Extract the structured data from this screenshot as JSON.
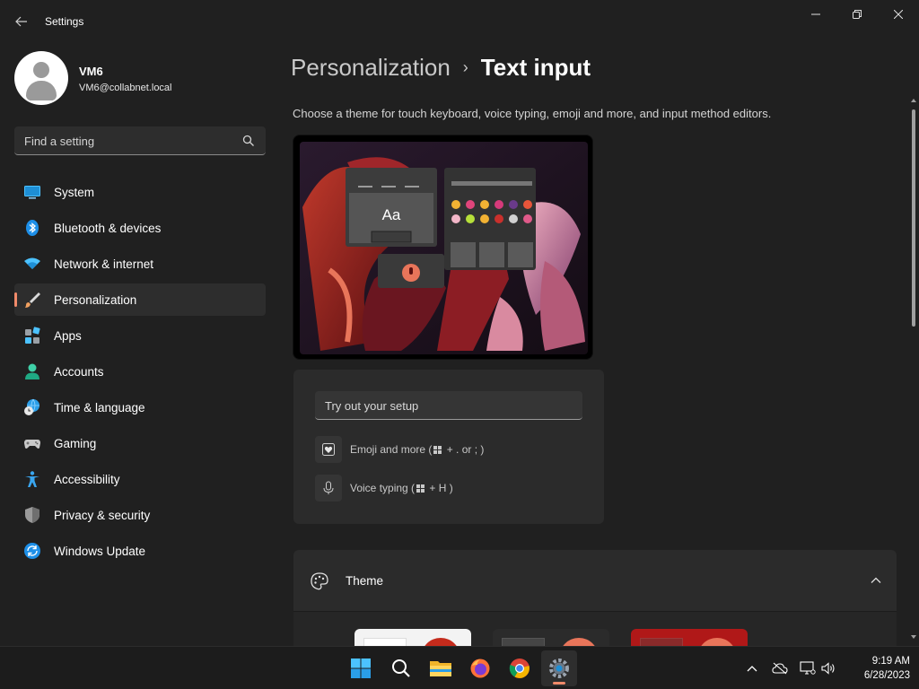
{
  "window": {
    "title": "Settings",
    "back_icon": "back-arrow-icon",
    "controls": [
      "minimize-icon",
      "restore-icon",
      "close-icon"
    ]
  },
  "profile": {
    "name": "VM6",
    "email": "VM6@collabnet.local"
  },
  "search": {
    "placeholder": "Find a setting"
  },
  "sidebar": {
    "items": [
      {
        "label": "System",
        "icon": "system-icon",
        "active": false
      },
      {
        "label": "Bluetooth & devices",
        "icon": "bluetooth-icon",
        "active": false
      },
      {
        "label": "Network & internet",
        "icon": "wifi-icon",
        "active": false
      },
      {
        "label": "Personalization",
        "icon": "brush-icon",
        "active": true
      },
      {
        "label": "Apps",
        "icon": "apps-icon",
        "active": false
      },
      {
        "label": "Accounts",
        "icon": "accounts-icon",
        "active": false
      },
      {
        "label": "Time & language",
        "icon": "globe-clock-icon",
        "active": false
      },
      {
        "label": "Gaming",
        "icon": "gamepad-icon",
        "active": false
      },
      {
        "label": "Accessibility",
        "icon": "accessibility-icon",
        "active": false
      },
      {
        "label": "Privacy & security",
        "icon": "shield-icon",
        "active": false
      },
      {
        "label": "Windows Update",
        "icon": "update-icon",
        "active": false
      }
    ]
  },
  "breadcrumb": {
    "parent": "Personalization",
    "separator": "›",
    "current": "Text input"
  },
  "main": {
    "description": "Choose a theme for touch keyboard, voice typing, emoji and more, and input method editors.",
    "preview": {
      "keyboard_sample": "Aa"
    },
    "tryout": {
      "placeholder": "Try out your setup",
      "emoji_label": "Emoji and more (",
      "emoji_shortcut": "+ . or ; )",
      "voice_label": "Voice typing (",
      "voice_shortcut": "+ H )"
    },
    "theme": {
      "label": "Theme",
      "expanded": true
    }
  },
  "taskbar": {
    "apps": [
      "windows-start-icon",
      "search-icon",
      "file-explorer-icon",
      "firefox-icon",
      "chrome-icon",
      "settings-icon"
    ],
    "active_app": "settings-icon"
  },
  "clock": {
    "time": "9:19 AM",
    "date": "6/28/2023"
  },
  "colors": {
    "accent": "#f08a6a",
    "background": "#202020",
    "card": "#2b2b2b"
  }
}
